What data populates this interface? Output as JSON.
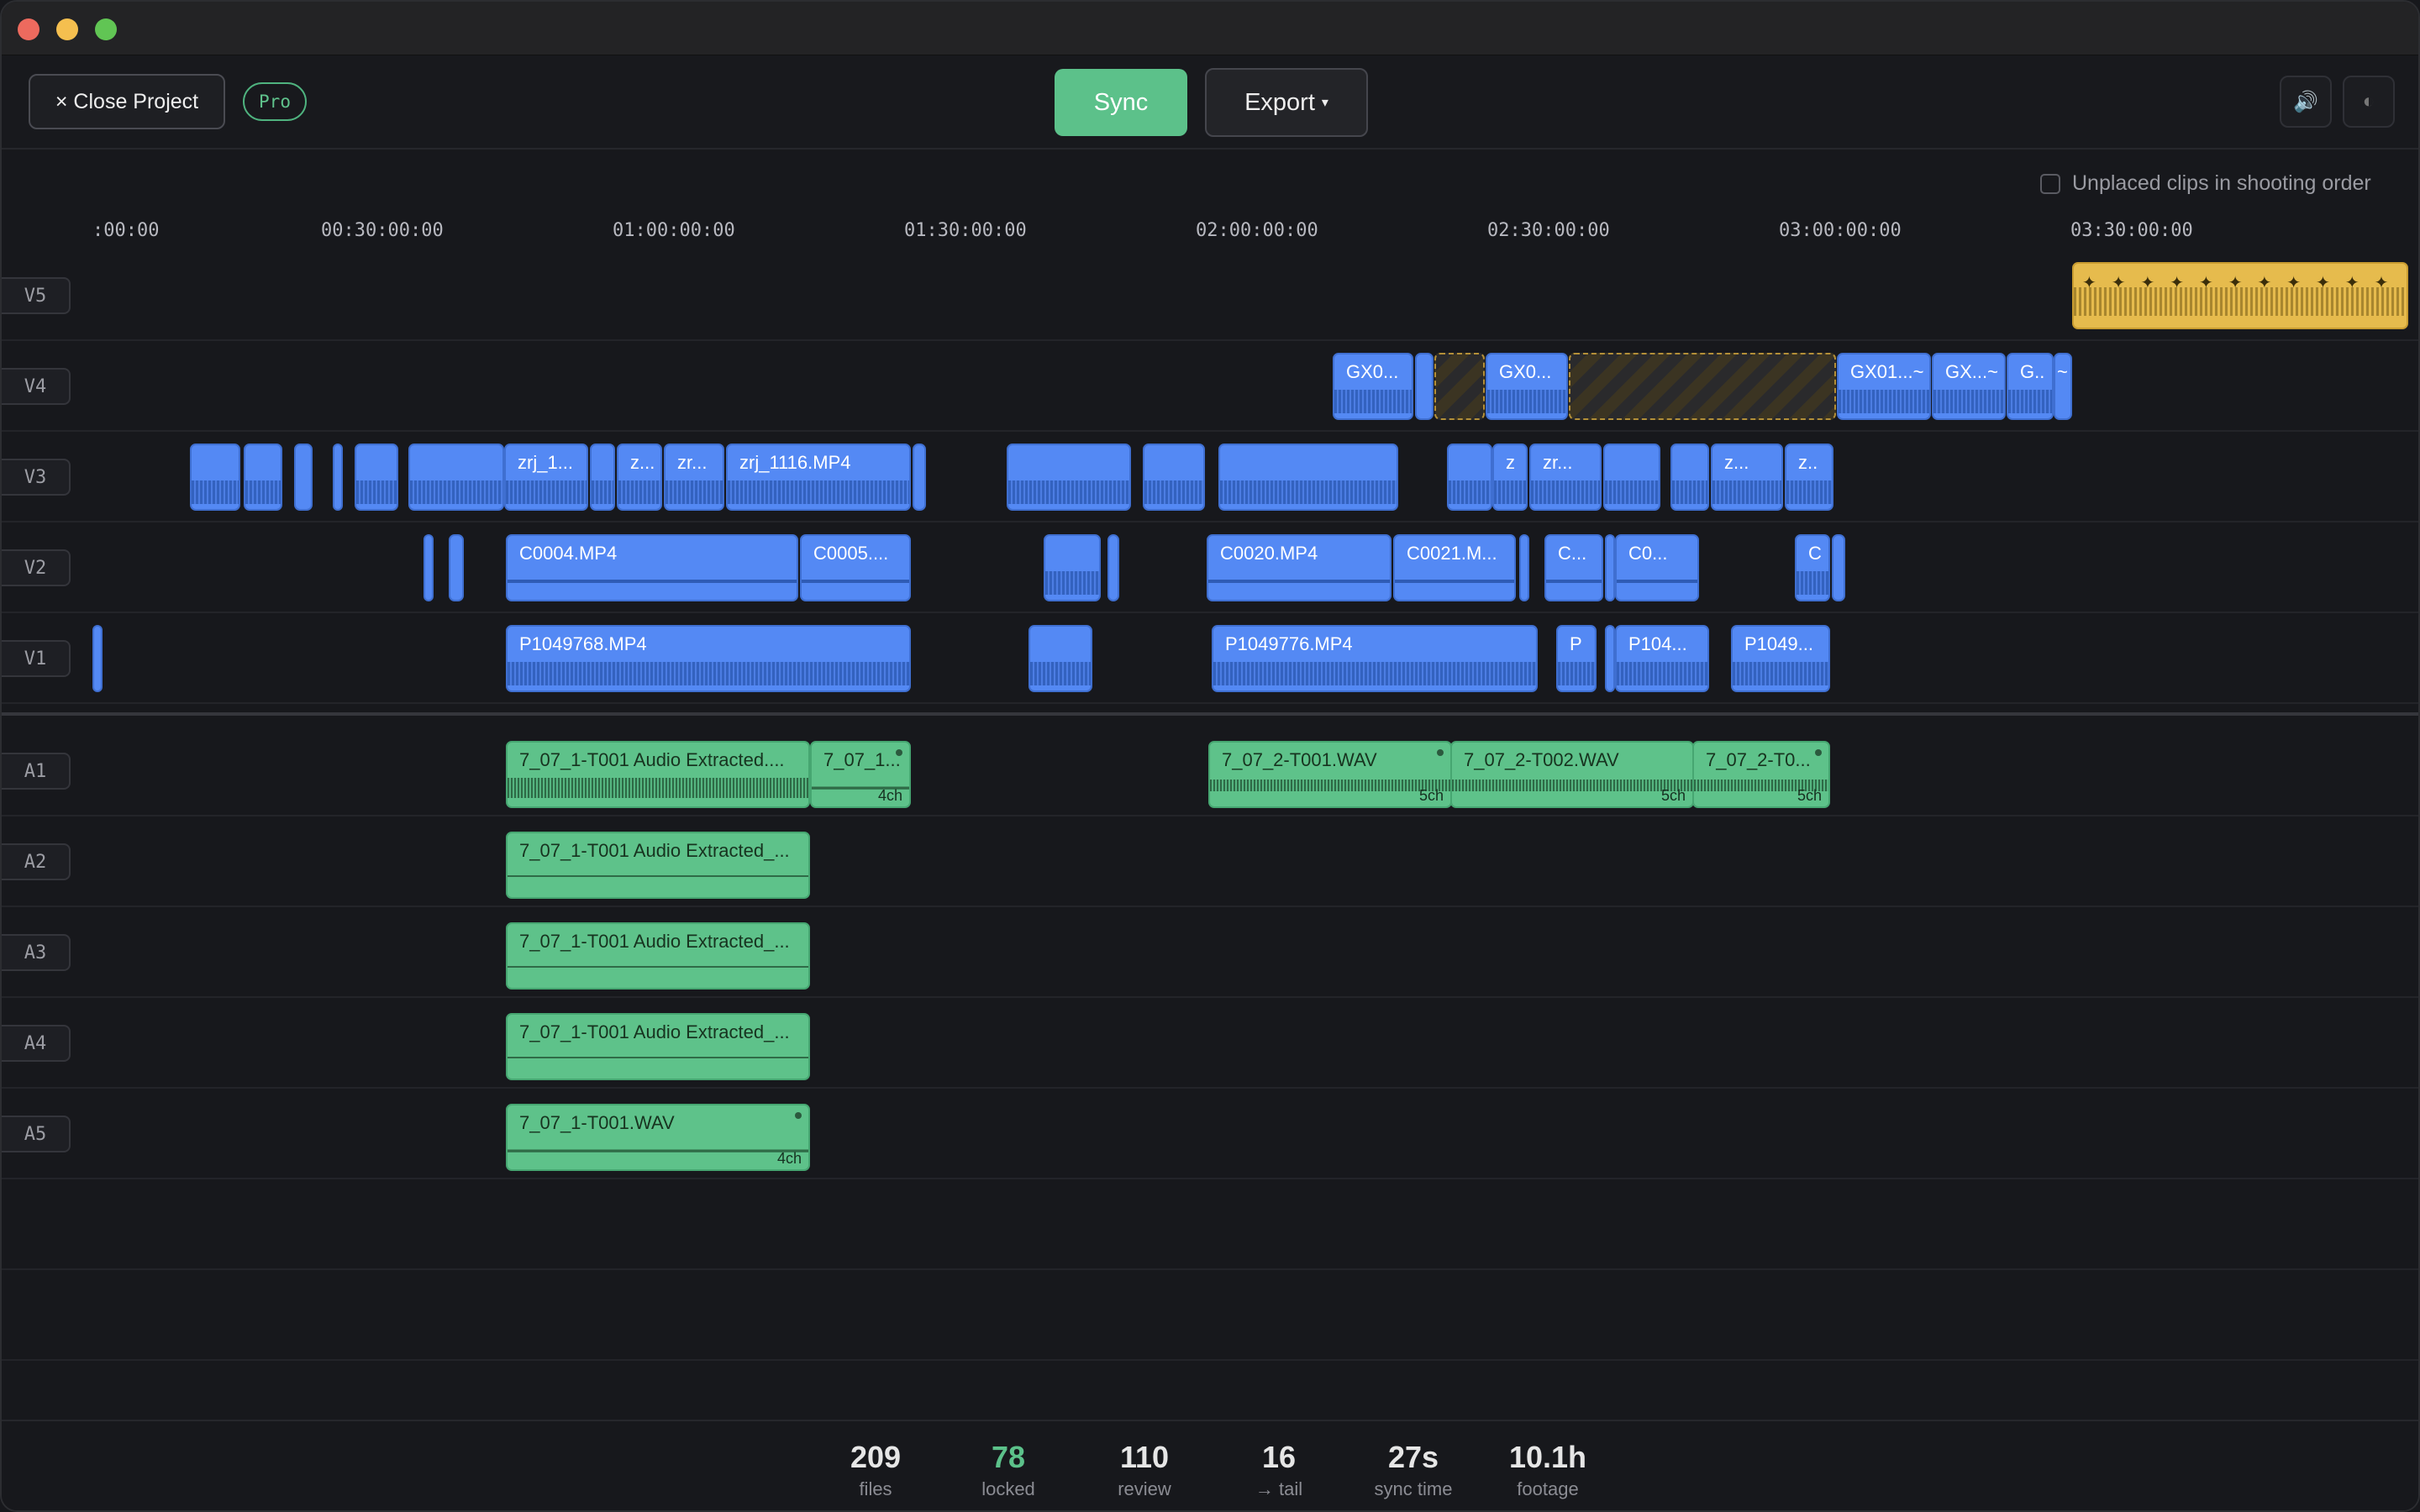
{
  "toolbar": {
    "close_label": "× Close Project",
    "pro_badge": "Pro",
    "sync_label": "Sync",
    "export_label": "Export",
    "export_caret": "▾",
    "volume_icon": "🔊",
    "theme_icon": "◐"
  },
  "options": {
    "unplaced_label": "Unplaced clips in shooting order",
    "unplaced_checked": false
  },
  "ruler": {
    "ticks": [
      ":00:00",
      "00:30:00:00",
      "01:00:00:00",
      "01:30:00:00",
      "02:00:00:00",
      "02:30:00:00",
      "03:00:00:00",
      "03:30:00:00"
    ]
  },
  "tracks": {
    "video": [
      "V5",
      "V4",
      "V3",
      "V2",
      "V1"
    ],
    "audio": [
      "A1",
      "A2",
      "A3",
      "A4",
      "A5"
    ]
  },
  "clips": {
    "v4": [
      "GX0...",
      "GX0...",
      "GX01...~",
      "GX...~",
      "G..",
      "~"
    ],
    "v3": [
      "zrj_1...",
      "z...",
      "zr...",
      "zrj_1116.MP4",
      "z",
      "zr...",
      "z...",
      "z.."
    ],
    "v2": [
      "C0004.MP4",
      "C0005....",
      "C0020.MP4",
      "C0021.M...",
      "C...",
      "C0...",
      "C"
    ],
    "v1": [
      "P1049768.MP4",
      "P1049776.MP4",
      "P",
      "P104...",
      "P1049..."
    ],
    "a1": [
      "7_07_1-T001 Audio Extracted....",
      "7_07_1...",
      "7_07_2-T001.WAV",
      "7_07_2-T002.WAV",
      "7_07_2-T0..."
    ],
    "a1_channels": [
      "4ch",
      "5ch",
      "5ch",
      "5ch"
    ],
    "a2": [
      "7_07_1-T001 Audio Extracted_..."
    ],
    "a3": [
      "7_07_1-T001 Audio Extracted_..."
    ],
    "a4": [
      "7_07_1-T001 Audio Extracted_..."
    ],
    "a5": [
      "7_07_1-T001.WAV"
    ],
    "a5_channels": [
      "4ch"
    ]
  },
  "stats": [
    {
      "value": "209",
      "label": "files"
    },
    {
      "value": "78",
      "label": "locked"
    },
    {
      "value": "110",
      "label": "review"
    },
    {
      "value": "16",
      "label": "→ tail"
    },
    {
      "value": "27s",
      "label": "sync time"
    },
    {
      "value": "10.1h",
      "label": "footage"
    }
  ],
  "colors": {
    "video_clip": "#5489f4",
    "audio_clip": "#5ec28a",
    "unplaced_clip": "#e6bb4d",
    "accent_green": "#5cc18a"
  }
}
